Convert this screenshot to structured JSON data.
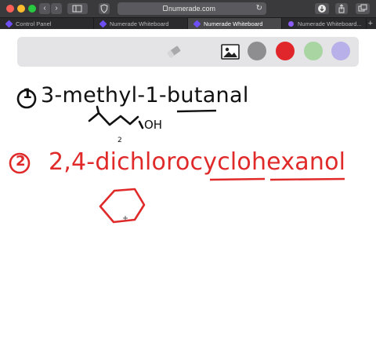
{
  "browser": {
    "url": "numerade.com",
    "tabs": [
      {
        "label": "Control Panel",
        "active": false
      },
      {
        "label": "Numerade Whiteboard",
        "active": false
      },
      {
        "label": "Numerade Whiteboard",
        "active": true
      },
      {
        "label": "Numerade Whiteboard...",
        "active": false
      }
    ],
    "new_tab_symbol": "+"
  },
  "toolbar": {
    "tools": [
      {
        "name": "eraser-icon"
      },
      {
        "name": "image-icon"
      }
    ],
    "colors": [
      {
        "name": "gray",
        "hex": "#8e8e90"
      },
      {
        "name": "red",
        "hex": "#e0262b"
      },
      {
        "name": "green",
        "hex": "#a8d5a2"
      },
      {
        "name": "purple",
        "hex": "#b8b0e8"
      }
    ]
  },
  "whiteboard": {
    "ink_black": "#111111",
    "ink_red": "#e02a2a",
    "line1": {
      "number": "1",
      "text": "3-methyl-1-butanal",
      "underlined": "butanal"
    },
    "structure1_label": "OH",
    "structure1_number": "2",
    "line2": {
      "number": "2",
      "text": "2,4-dichlorocyclohexanol",
      "underlined": [
        "cyclo",
        "hexanol"
      ]
    }
  }
}
